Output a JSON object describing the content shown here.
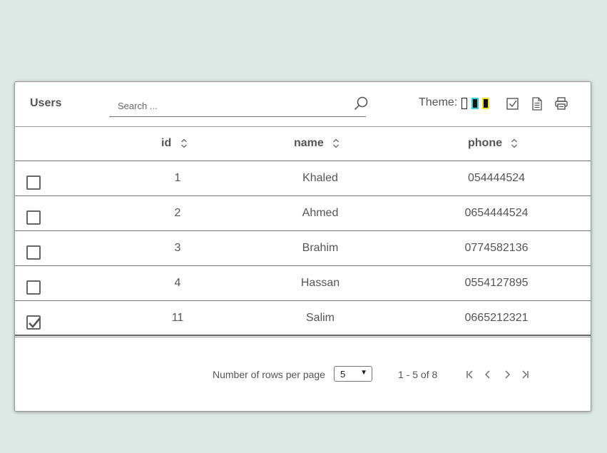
{
  "table": {
    "title": "Users",
    "search": {
      "placeholder": "Search ...",
      "value": ""
    },
    "theme_label": "Theme:",
    "columns": [
      "id",
      "name",
      "phone"
    ],
    "rows": [
      {
        "checked": false,
        "id": "1",
        "name": "Khaled",
        "phone": "054444524"
      },
      {
        "checked": false,
        "id": "2",
        "name": "Ahmed",
        "phone": "0654444524"
      },
      {
        "checked": false,
        "id": "3",
        "name": "Brahim",
        "phone": "0774582136"
      },
      {
        "checked": false,
        "id": "4",
        "name": "Hassan",
        "phone": "0554127895"
      },
      {
        "checked": true,
        "id": "11",
        "name": "Salim",
        "phone": "0665212321"
      }
    ],
    "footer": {
      "rows_per_page_label": "Number of rows per page",
      "rows_per_page_value": "5",
      "range": "1 - 5 of 8"
    }
  },
  "icons": {
    "search": "search-icon",
    "select_all": "checkbox-check-icon",
    "export": "document-icon",
    "print": "printer-icon",
    "sort": "sort-icon",
    "first_page": "first-page-icon",
    "prev_page": "prev-page-icon",
    "next_page": "next-page-icon",
    "last_page": "last-page-icon"
  },
  "colors": {
    "background": "#dde9e5",
    "theme_swatches": [
      "#ffffff",
      "#2fd0e0",
      "#f0e020"
    ]
  }
}
